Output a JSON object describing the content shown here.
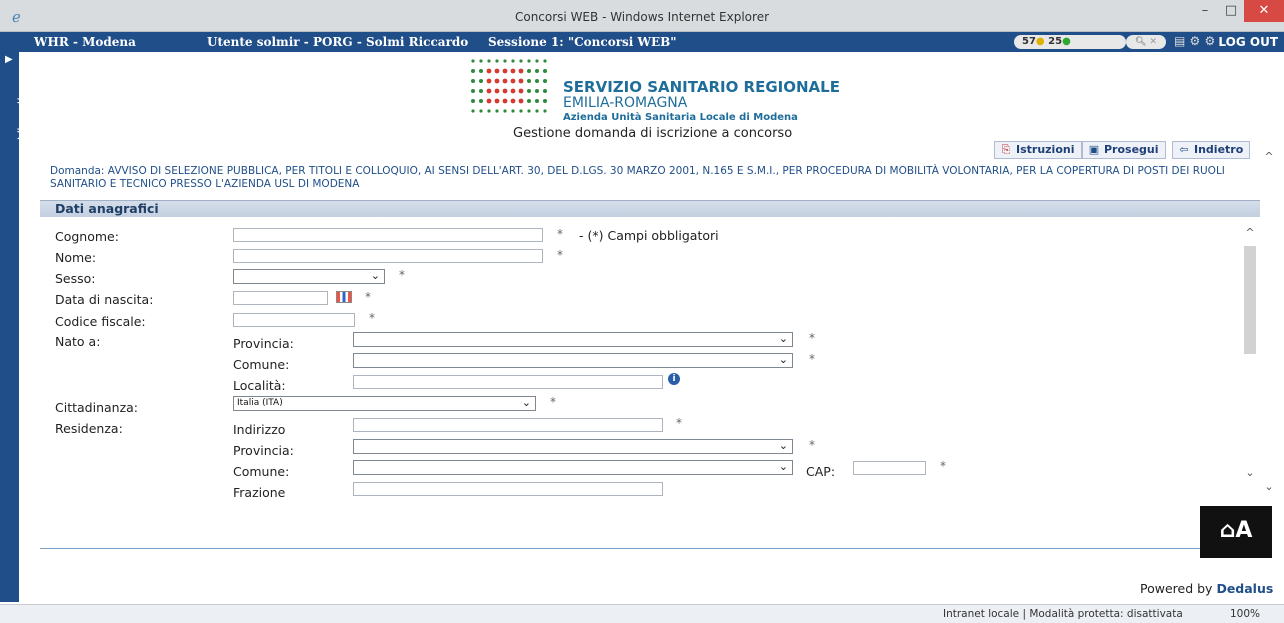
{
  "window": {
    "title": "Concorsi WEB - Windows Internet Explorer",
    "minimize": "–",
    "maximize": "□",
    "close": "✕"
  },
  "appbar": {
    "site": "WHR - Modena",
    "user": "Utente solmir - PORG - Solmi Riccardo",
    "session": "Sessione 1: \"Concorsi WEB\"",
    "counter1": "57",
    "counter2": "25",
    "logout": "LOG OUT"
  },
  "sidebar": {
    "label": "Visualizza"
  },
  "header": {
    "org1": "SERVIZIO SANITARIO REGIONALE",
    "org2": "EMILIA-ROMAGNA",
    "org3": "Azienda Unità Sanitaria Locale di Modena",
    "page_title": "Gestione domanda di iscrizione a concorso"
  },
  "toolbar": {
    "istruzioni": "Istruzioni",
    "prosegui": "Prosegui",
    "indietro": "Indietro"
  },
  "domanda": "Domanda: AVVISO DI SELEZIONE PUBBLICA, PER TITOLI E COLLOQUIO, AI SENSI DELL'ART. 30, DEL D.LGS. 30 MARZO 2001, N.165 E S.M.I., PER PROCEDURA DI MOBILITÀ VOLONTARIA, PER LA COPERTURA DI POSTI DEI RUOLI SANITARIO E TECNICO PRESSO L'AZIENDA USL DI MODENA",
  "section_title": "Dati anagrafici",
  "form": {
    "asterisk": "*",
    "required_note": "- (*) Campi obbligatori",
    "cognome": "Cognome:",
    "nome": "Nome:",
    "sesso": "Sesso:",
    "data_nascita": "Data di nascita:",
    "codice_fiscale": "Codice fiscale:",
    "nato_a": "Nato a:",
    "provincia": "Provincia:",
    "comune": "Comune:",
    "localita": "Località:",
    "cittadinanza": "Cittadinanza:",
    "cittadinanza_value": "Italia (ITA)",
    "residenza": "Residenza:",
    "indirizzo": "Indirizzo",
    "cap": "CAP:",
    "frazione": "Frazione"
  },
  "footer": {
    "powered_by": "Powered by",
    "brand": "Dedalus"
  },
  "statusbar": {
    "zone": "Intranet locale | Modalità protetta: disattivata",
    "zoom": "100%"
  },
  "icons": [
    "ie-logo-icon",
    "pdf-icon",
    "save-icon",
    "back-icon",
    "calendar-icon",
    "info-icon",
    "chevron-down-icon",
    "arrow-right-icon",
    "accessibility-icon"
  ],
  "colors": {
    "accent": "#1f4e89",
    "brand": "#1e6d9b",
    "close": "#d64a43"
  }
}
